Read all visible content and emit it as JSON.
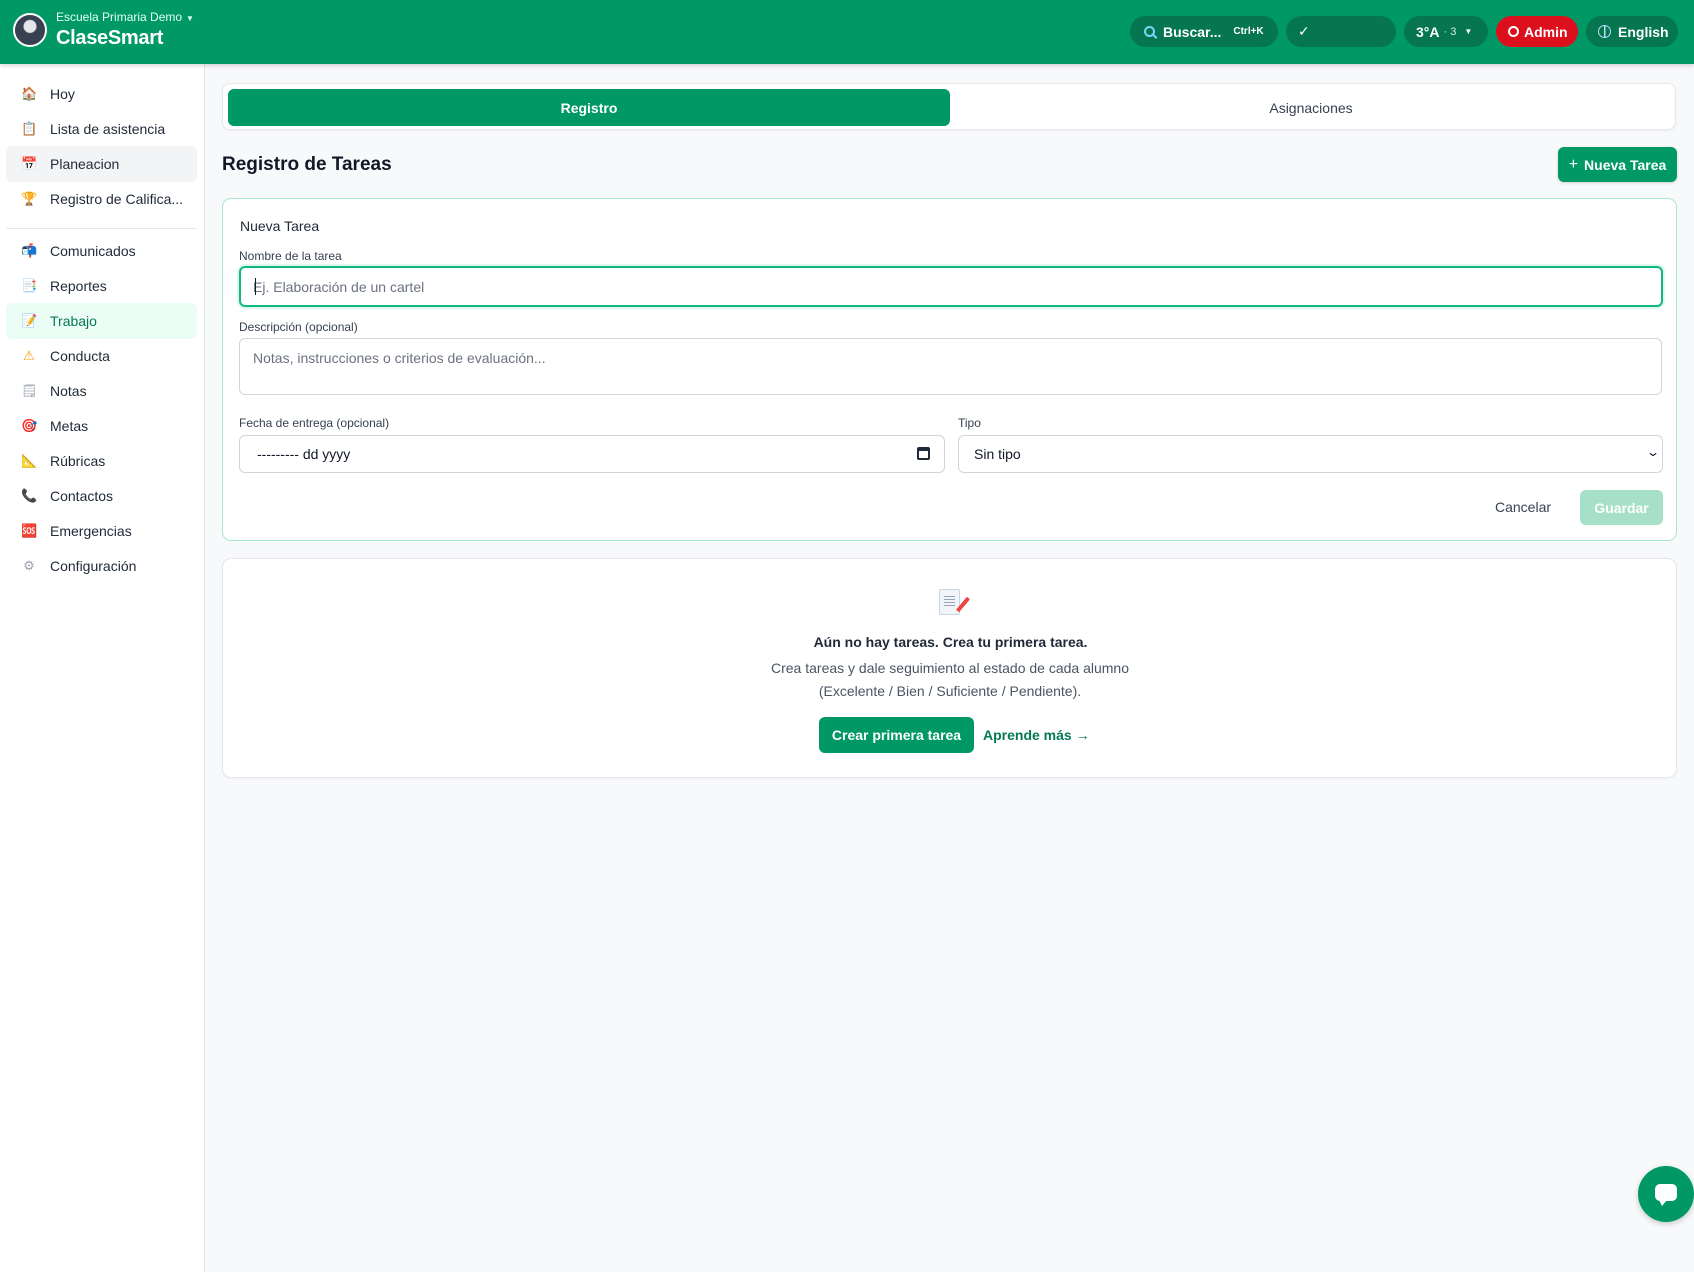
{
  "header": {
    "school": "Escuela Primaria Demo",
    "brand": "ClaseSmart",
    "search_label": "Buscar...",
    "search_shortcut": "Ctrl+K",
    "check_label": "✓",
    "class_label": "3°A",
    "class_count": "· 3",
    "admin_label": "Admin",
    "language_label": "English",
    "colors": {
      "primary": "#009966",
      "admin": "#dc0f1d"
    }
  },
  "sidebar": {
    "items": [
      {
        "label": "Hoy",
        "icon": "house-icon",
        "glyph": "🏠"
      },
      {
        "label": "Lista de asistencia",
        "icon": "clipboard-icon",
        "glyph": "📋"
      },
      {
        "label": "Planeacion",
        "icon": "calendar-icon",
        "glyph": "📅"
      },
      {
        "label": "Registro de Califica...",
        "icon": "trophy-icon",
        "glyph": "🏆"
      },
      {
        "label": "Comunicados",
        "icon": "mailbox-icon",
        "glyph": "📬"
      },
      {
        "label": "Reportes",
        "icon": "report-icon",
        "glyph": "📑"
      },
      {
        "label": "Trabajo",
        "icon": "memo-icon",
        "glyph": "📝"
      },
      {
        "label": "Conducta",
        "icon": "warning-icon",
        "glyph": "⚠"
      },
      {
        "label": "Notas",
        "icon": "notepad-icon",
        "glyph": "🗒"
      },
      {
        "label": "Metas",
        "icon": "target-icon",
        "glyph": "🎯"
      },
      {
        "label": "Rúbricas",
        "icon": "ruler-icon",
        "glyph": "📐"
      },
      {
        "label": "Contactos",
        "icon": "phone-icon",
        "glyph": "📞"
      },
      {
        "label": "Emergencias",
        "icon": "sos-icon",
        "glyph": "🆘"
      },
      {
        "label": "Configuración",
        "icon": "gear-icon",
        "glyph": "⚙"
      }
    ]
  },
  "tabs": [
    {
      "label": "Registro",
      "active": true
    },
    {
      "label": "Asignaciones",
      "active": false
    }
  ],
  "main": {
    "title": "Registro de Tareas",
    "new_button": "Nueva Tarea",
    "form": {
      "title": "Nueva Tarea",
      "name_label": "Nombre de la tarea",
      "name_placeholder": "Ej. Elaboración de un cartel",
      "name_value": "",
      "description_label": "Descripción (opcional)",
      "description_placeholder": "Notas, instrucciones o criterios de evaluación...",
      "date_label": "Fecha de entrega (opcional)",
      "date_value": "--------- dd yyyy",
      "type_label": "Tipo",
      "type_value": "Sin tipo",
      "cancel_label": "Cancelar",
      "save_label": "Guardar"
    },
    "empty": {
      "title": "Aún no hay tareas. Crea tu primera tarea.",
      "description": "Crea tareas y dale seguimiento al estado de cada alumno (Excelente / Bien / Suficiente / Pendiente).",
      "create_label": "Crear primera tarea",
      "learn_label": "Aprende más →"
    }
  }
}
